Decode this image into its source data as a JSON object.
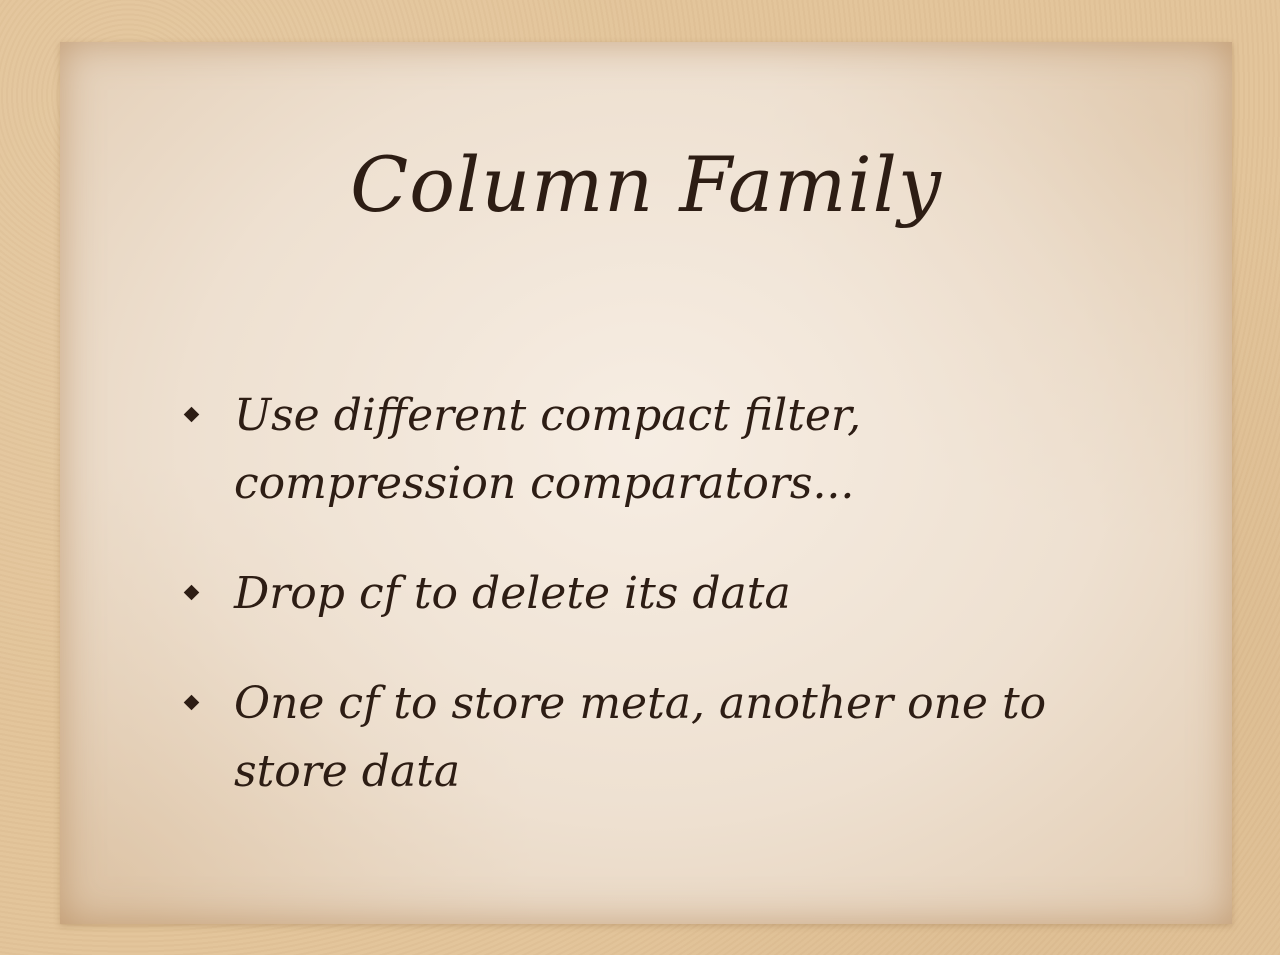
{
  "slide": {
    "title": "Column Family",
    "bullets": [
      "Use different compact filter, compression comparators...",
      "Drop cf to delete its data",
      "One cf to store meta, another one to store data"
    ]
  },
  "colors": {
    "background": "#e3c59b",
    "paper": "#eee1d2",
    "text": "#2d1d14"
  }
}
